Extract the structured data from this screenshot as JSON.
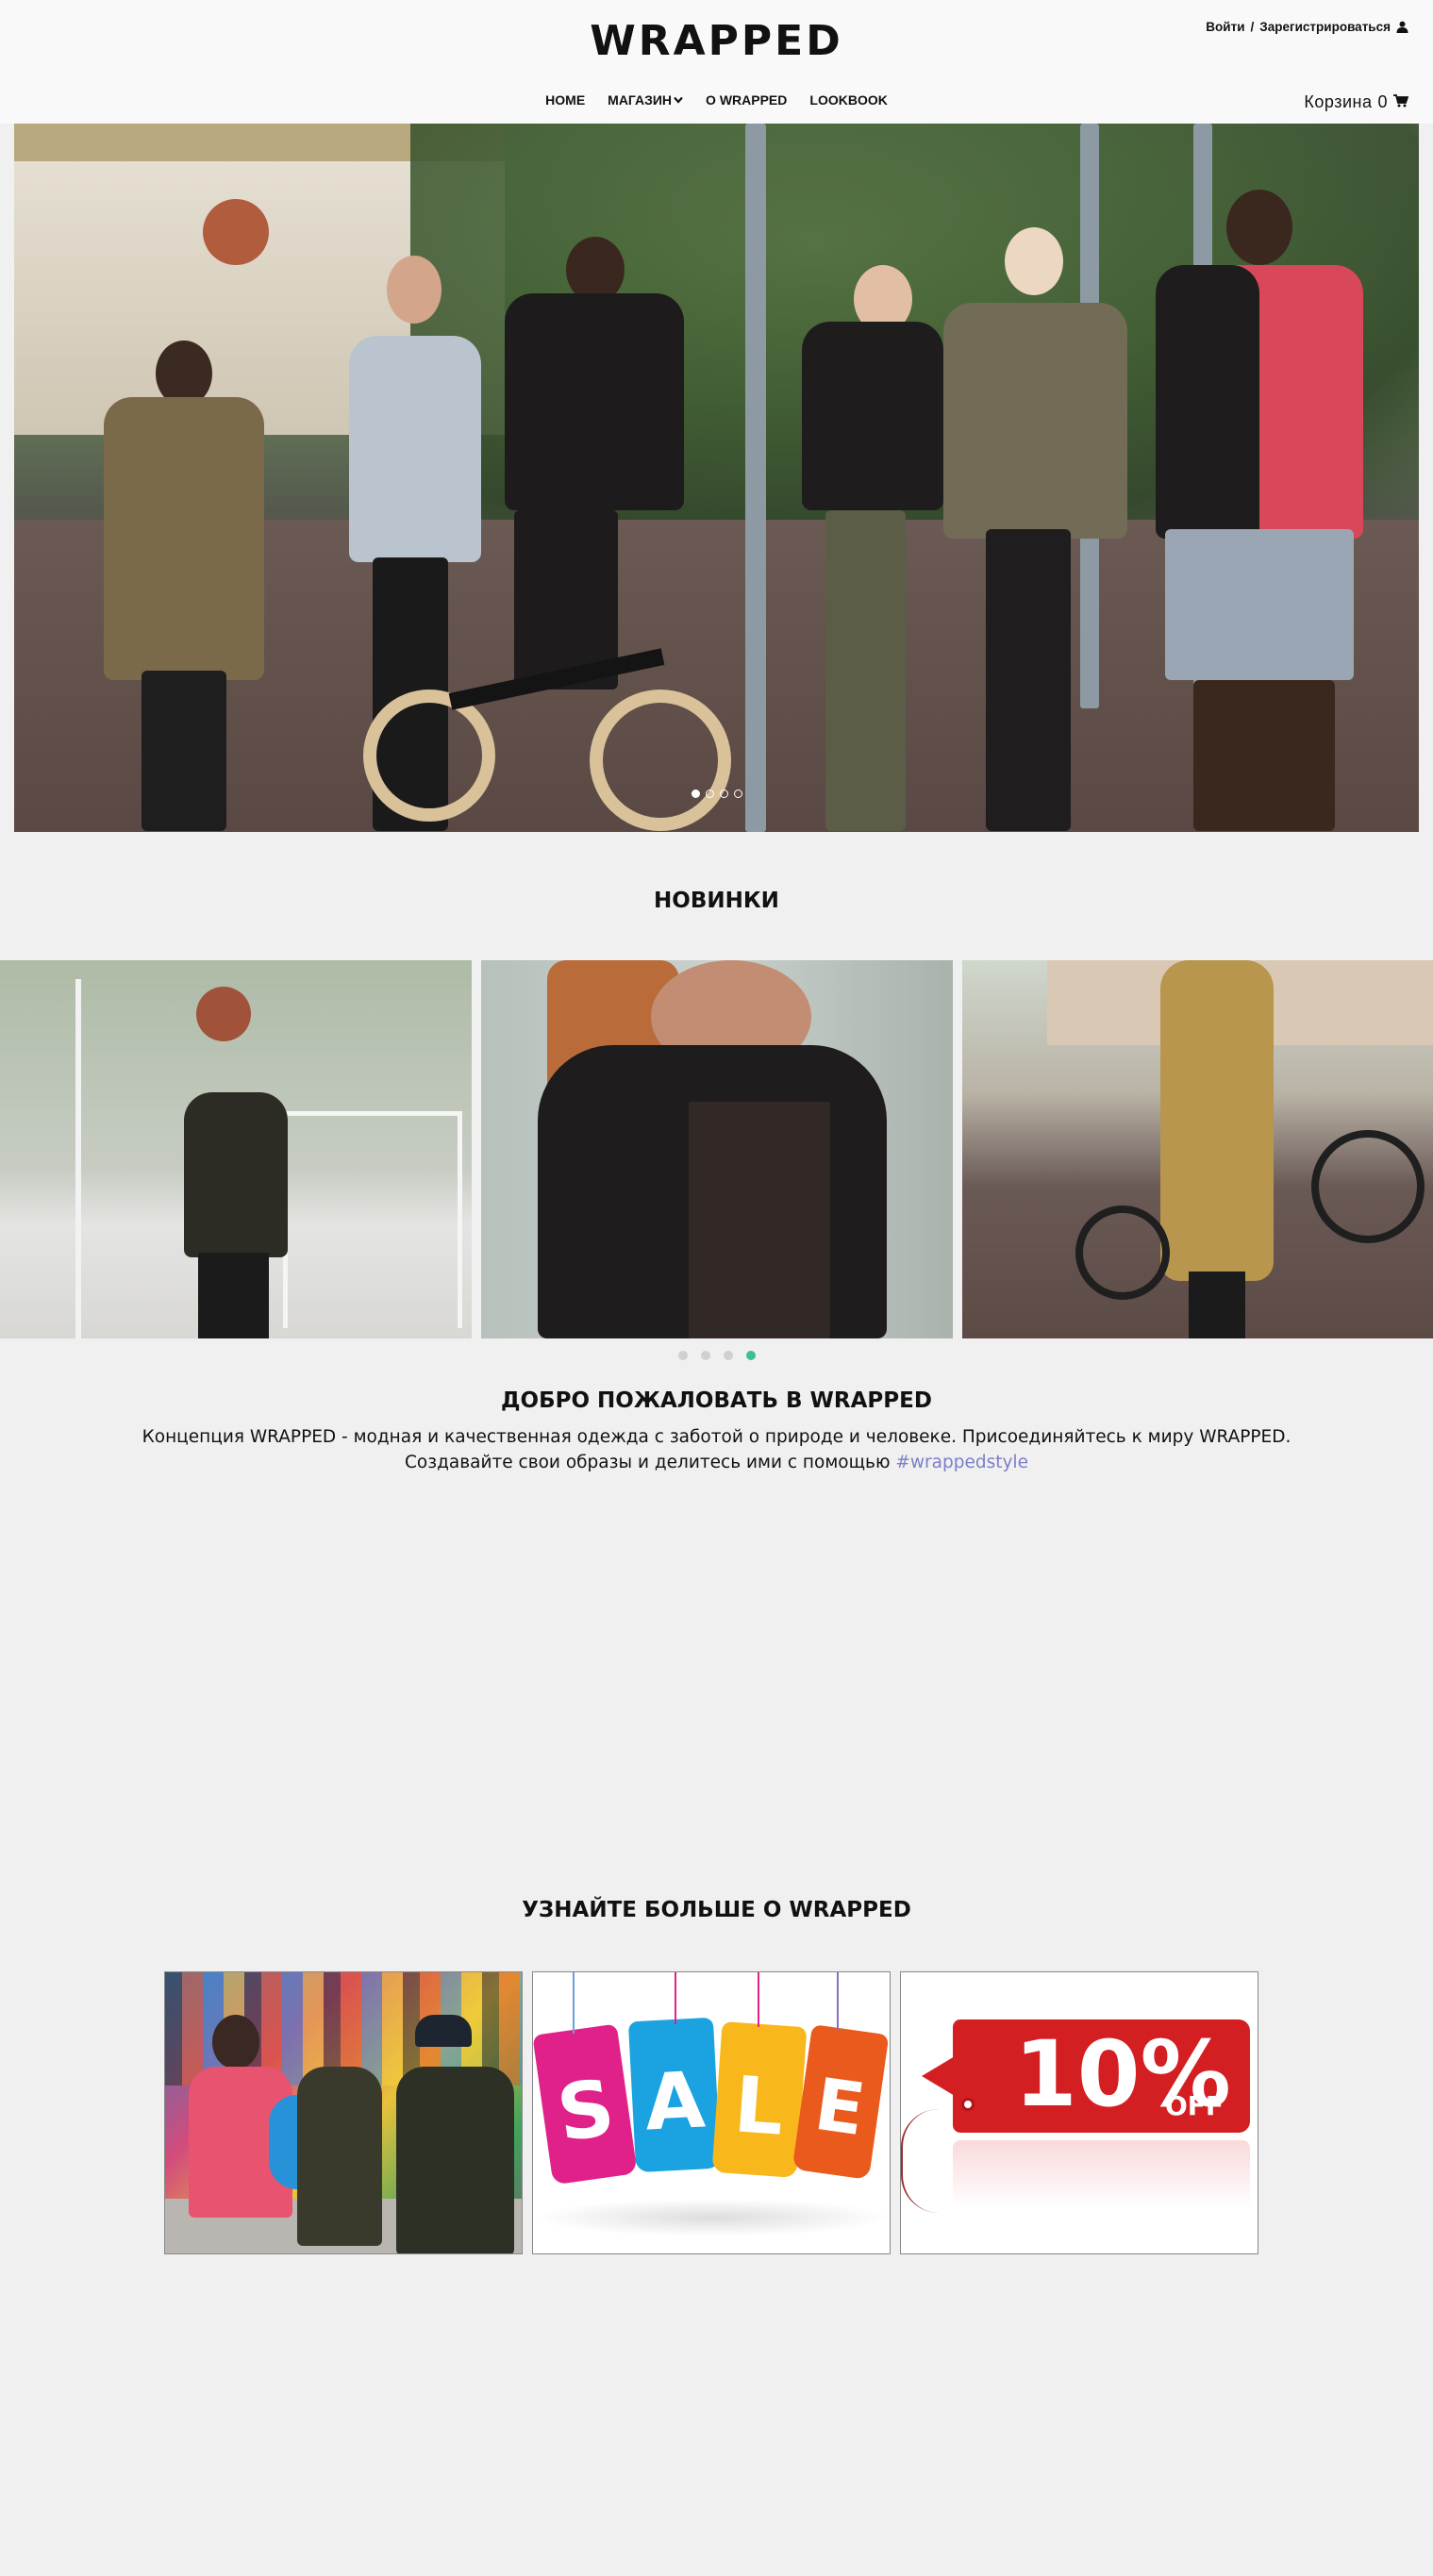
{
  "header": {
    "logo": "WRAPPED",
    "auth": {
      "login": "Войти",
      "separator": "/",
      "register": "Зарегистрироваться",
      "icon": "user-icon"
    },
    "nav": [
      {
        "label": "HOME"
      },
      {
        "label": "МАГАЗИН",
        "icon": "chevron-down-icon"
      },
      {
        "label": "О WRAPPED"
      },
      {
        "label": "LOOKBOOK"
      }
    ],
    "cart": {
      "label": "Корзина",
      "count": "0",
      "icon": "cart-icon"
    }
  },
  "hero": {
    "slides_total": 4,
    "active_slide": 1
  },
  "new_arrivals": {
    "title": "НОВИНКИ",
    "dots_total": 4,
    "active_dot": 4
  },
  "welcome": {
    "title": "ДОБРО ПОЖАЛОВАТЬ В WRAPPED",
    "line1": "Концепция WRAPPED - модная и качественная одежда с заботой о природе и человеке. Присоединяйтесь к миру WRAPPED.",
    "line2": "Создавайте свои образы и делитесь ими с помощью",
    "hashtag": "#wrappedstyle",
    "hashtag_color": "#7b7fc8"
  },
  "learn_more": {
    "title": "УЗНАЙТЕ БОЛЬШЕ О WRAPPED",
    "tiles": [
      {
        "name": "family-photo"
      },
      {
        "name": "sale-tags",
        "letters": [
          "S",
          "A",
          "L",
          "E"
        ]
      },
      {
        "name": "discount-tag",
        "percent": "10%",
        "off": "OFF"
      }
    ]
  },
  "colors": {
    "accent_dot": "#3fbf8f",
    "background": "#f0f0f0",
    "header_bg": "#f9f9f9"
  }
}
